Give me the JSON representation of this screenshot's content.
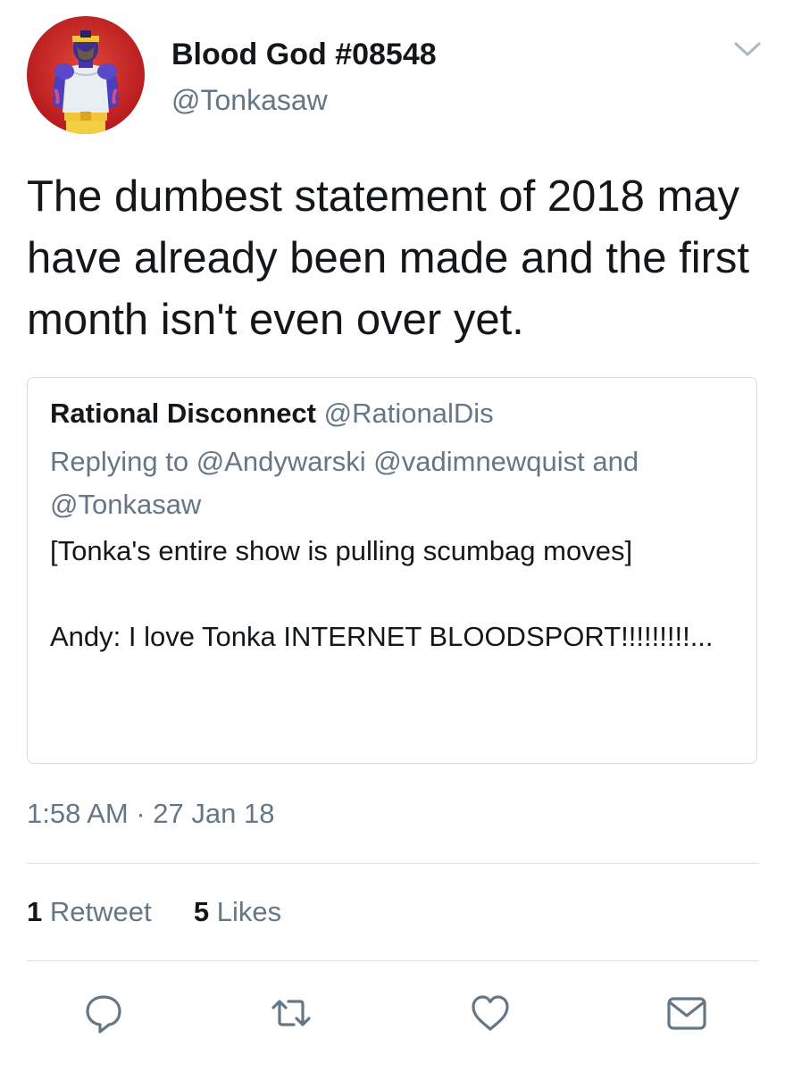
{
  "tweet": {
    "display_name": "Blood God #08548",
    "handle": "@Tonkasaw",
    "text": "The dumbest statement of 2018 may have already been made and the first month isn't even over yet.",
    "timestamp": "1:58 AM · 27 Jan 18"
  },
  "quoted_tweet": {
    "display_name": "Rational Disconnect",
    "handle": "@RationalDis",
    "reply_context": "Replying to @Andywarski @vadimnewquist and @Tonkasaw",
    "text": "[Tonka's entire show is pulling scumbag moves]\n\nAndy: I love Tonka INTERNET BLOODSPORT!!!!!!!!!..."
  },
  "stats": {
    "retweets_count": "1",
    "retweets_label": "Retweet",
    "likes_count": "5",
    "likes_label": "Likes"
  },
  "actions": [
    {
      "icon": "reply-icon"
    },
    {
      "icon": "retweet-icon"
    },
    {
      "icon": "heart-icon"
    },
    {
      "icon": "envelope-icon"
    }
  ],
  "colors": {
    "text_primary": "#14171a",
    "text_secondary": "#657786",
    "icon": "#657786",
    "border": "#d3dde5",
    "avatar_background": "#d42a25"
  }
}
